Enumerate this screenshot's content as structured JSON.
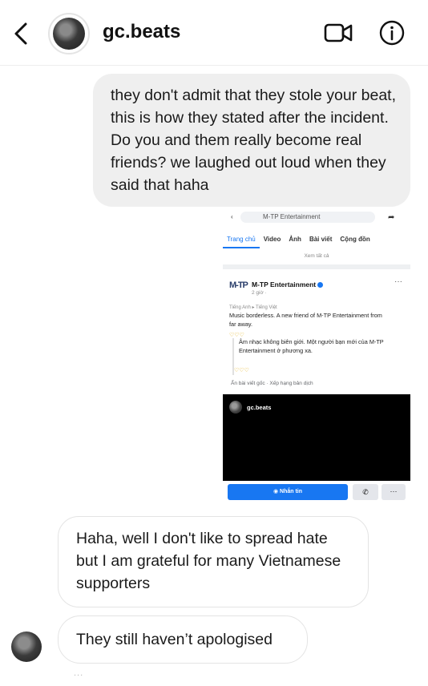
{
  "header": {
    "title": "gc.beats",
    "back_icon": "chevron-left-icon",
    "video_icon": "video-call-icon",
    "info_icon": "info-icon"
  },
  "messages": [
    {
      "direction": "sent",
      "text": "they don't admit that they stole your beat, this is how they stated after the incident. Do you and them really become real friends? we laughed out loud when they said that haha"
    },
    {
      "direction": "received",
      "text": "Haha, well I don't like to spread hate but I am grateful for many Vietnamese supporters"
    },
    {
      "direction": "received",
      "text": "They still haven’t apologised"
    }
  ],
  "shared_screenshot": {
    "search_text": "M-TP Entertainment",
    "tabs": [
      "Trang chủ",
      "Video",
      "Ảnh",
      "Bài viết",
      "Cộng đồn"
    ],
    "see_all": "Xem tất cả",
    "logo": "M-TP",
    "page_name": "M-TP Entertainment",
    "post_time": "2 giờ · ",
    "language_note": "Tiếng Anh ▸ Tiếng Việt",
    "post_text": "Music borderless. A new friend of M-TP Entertainment from far away.",
    "emoji": "♡♡♡",
    "translation": "Âm nhạc không biên giới. Một người bạn mới của M-TP Entertainment ở phương xa.",
    "translation_links": "Ẩn bài viết gốc · Xếp hạng bản dịch",
    "video_user": "gc.beats",
    "message_button": "Nhắn tin",
    "call_icon": "phone-icon",
    "more_icon": "more-horizontal-icon"
  },
  "footer_reaction": "..."
}
